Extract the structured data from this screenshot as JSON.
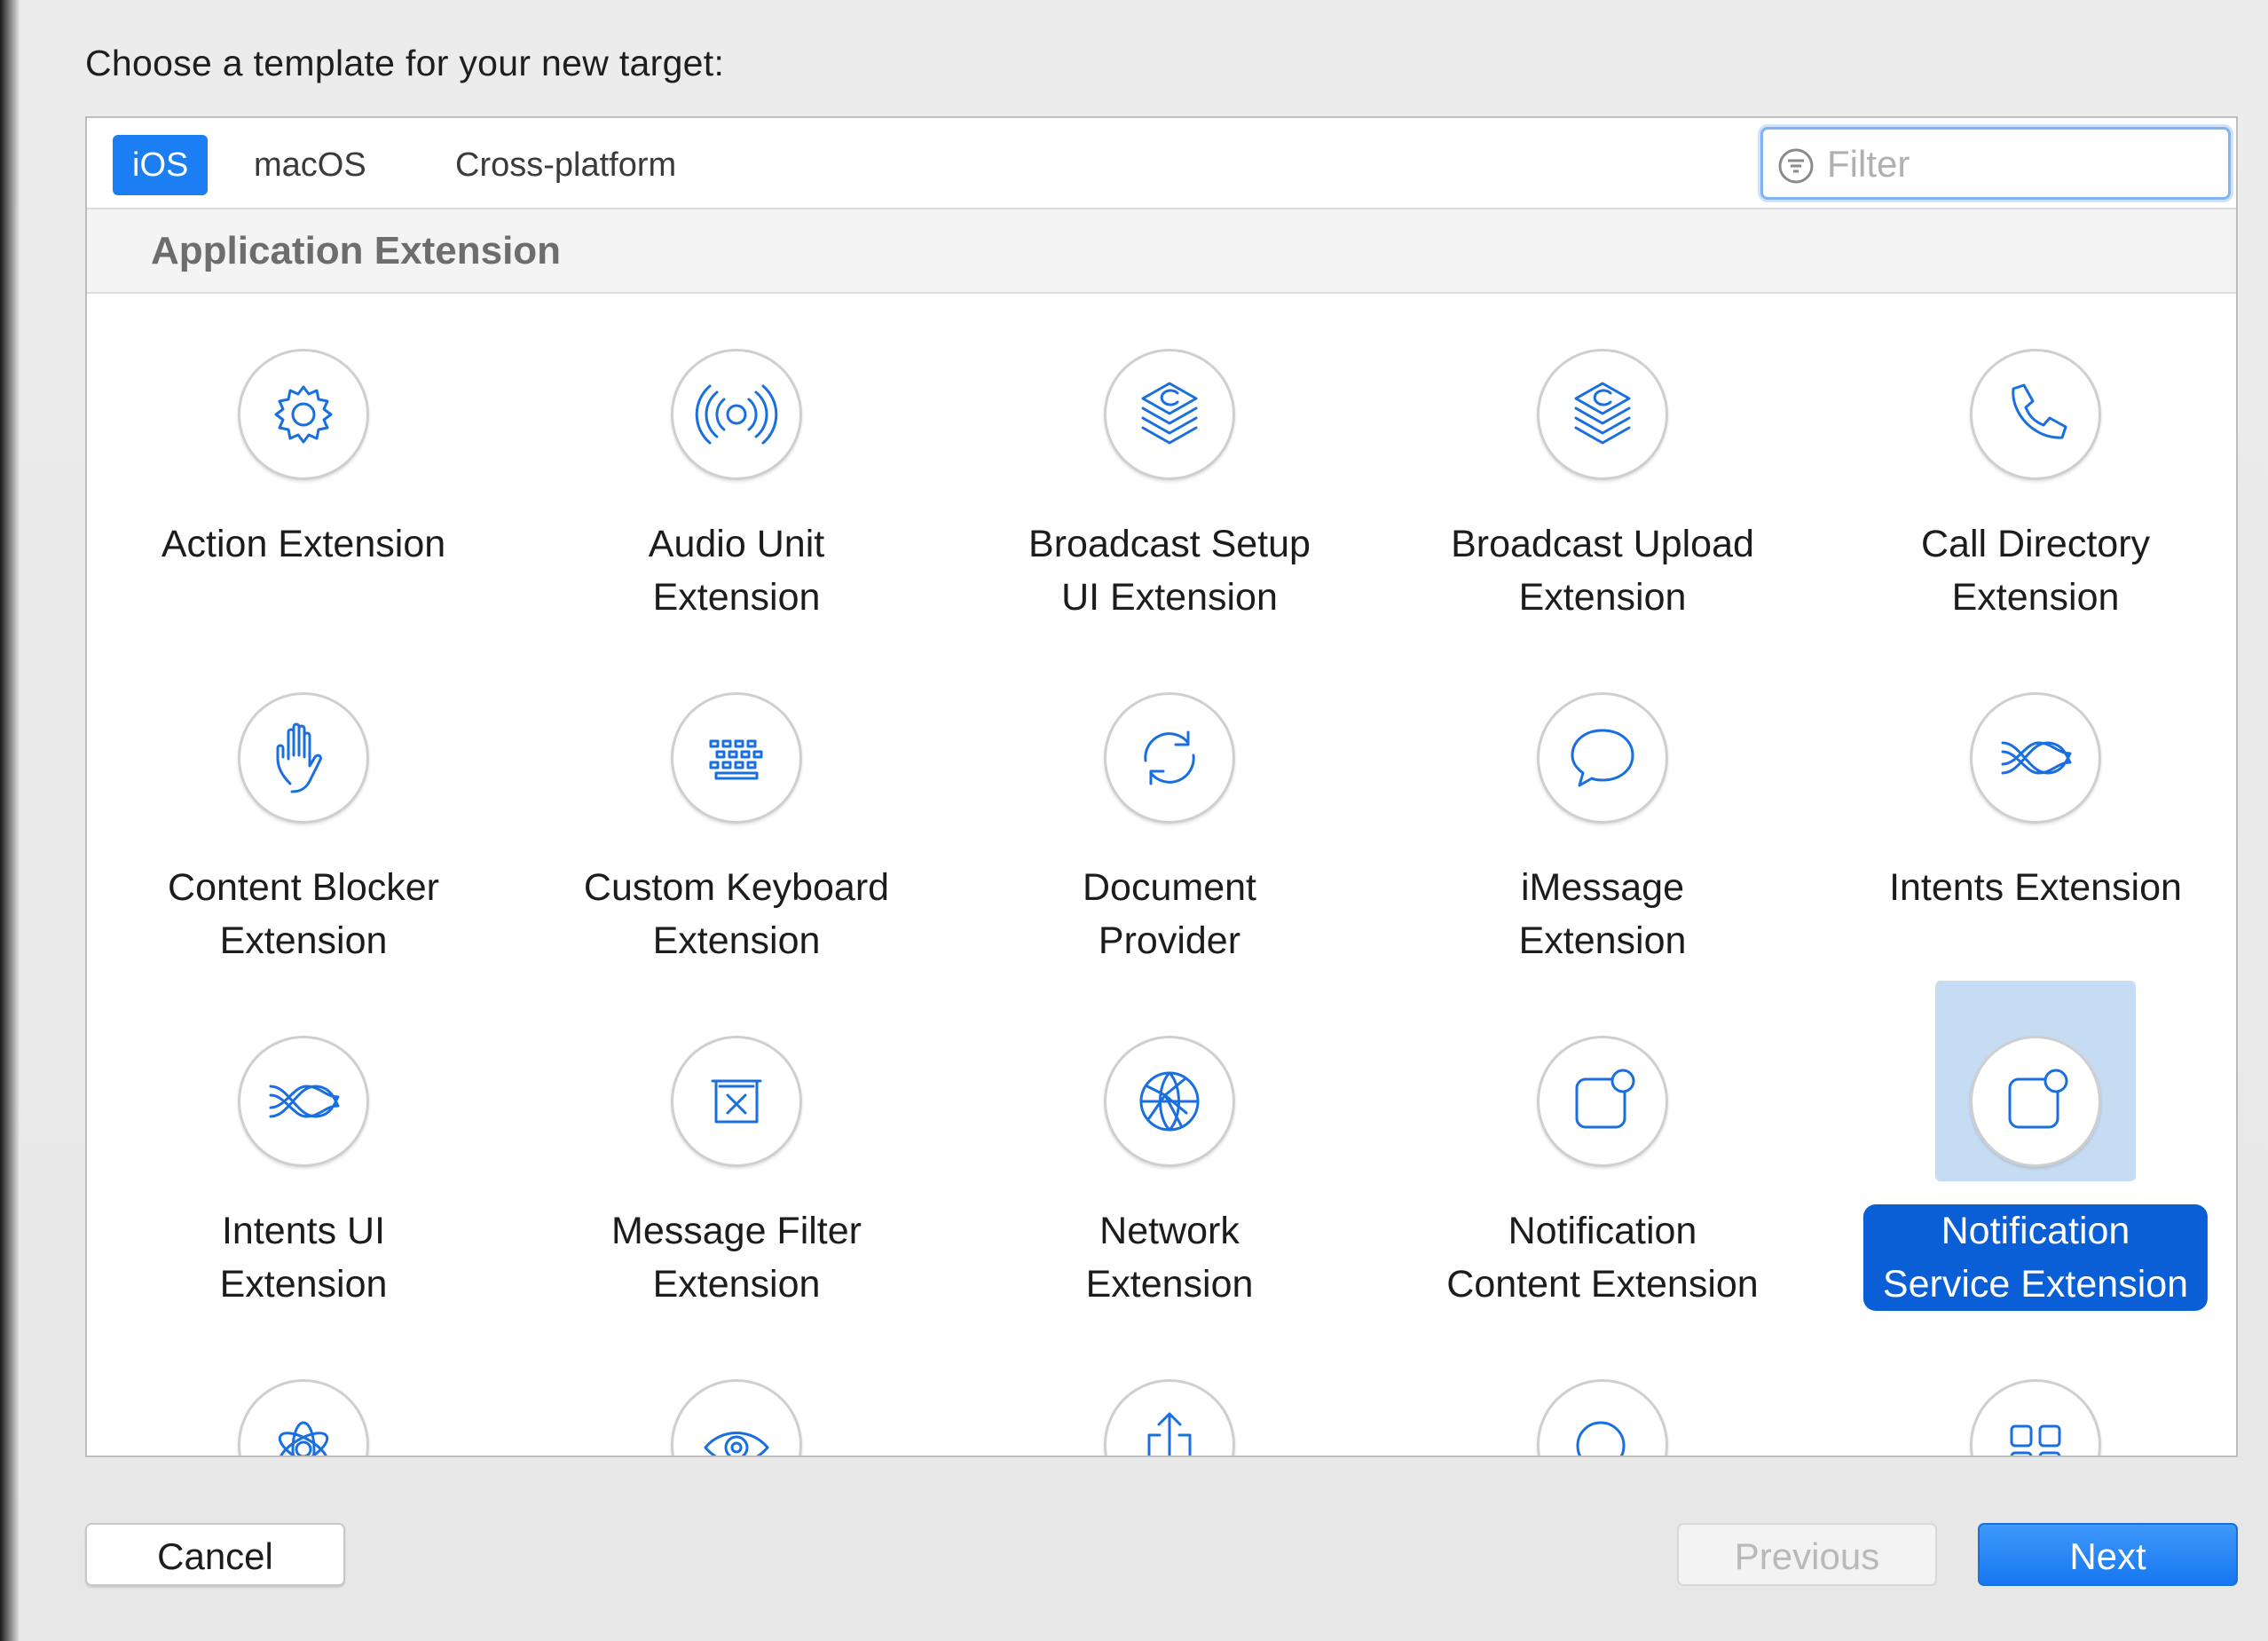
{
  "prompt": "Choose a template for your new target:",
  "tabs": [
    {
      "label": "iOS",
      "active": true
    },
    {
      "label": "macOS",
      "active": false
    },
    {
      "label": "Cross-platform",
      "active": false
    }
  ],
  "filter": {
    "placeholder": "Filter",
    "value": ""
  },
  "section_title": "Application Extension",
  "templates": [
    {
      "icon": "gear-icon",
      "lines": [
        "Action Extension"
      ]
    },
    {
      "icon": "audio-waves-icon",
      "lines": [
        "Audio Unit",
        "Extension"
      ]
    },
    {
      "icon": "broadcast-stack-icon",
      "lines": [
        "Broadcast Setup",
        "UI Extension"
      ]
    },
    {
      "icon": "broadcast-stack-icon",
      "lines": [
        "Broadcast Upload",
        "Extension"
      ]
    },
    {
      "icon": "phone-icon",
      "lines": [
        "Call Directory",
        "Extension"
      ]
    },
    {
      "icon": "hand-icon",
      "lines": [
        "Content Blocker",
        "Extension"
      ]
    },
    {
      "icon": "keyboard-icon",
      "lines": [
        "Custom Keyboard",
        "Extension"
      ]
    },
    {
      "icon": "sync-arrows-icon",
      "lines": [
        "Document",
        "Provider"
      ]
    },
    {
      "icon": "speech-bubble-icon",
      "lines": [
        "iMessage",
        "Extension"
      ]
    },
    {
      "icon": "intents-waves-icon",
      "lines": [
        "Intents Extension"
      ]
    },
    {
      "icon": "intents-waves-icon",
      "lines": [
        "Intents UI",
        "Extension"
      ]
    },
    {
      "icon": "filter-box-icon",
      "lines": [
        "Message Filter",
        "Extension"
      ]
    },
    {
      "icon": "globe-network-icon",
      "lines": [
        "Network",
        "Extension"
      ]
    },
    {
      "icon": "notification-icon",
      "lines": [
        "Notification",
        "Content Extension"
      ]
    },
    {
      "icon": "notification-icon",
      "lines": [
        "Notification",
        "Service Extension"
      ],
      "selected": true
    },
    {
      "icon": "flower-icon",
      "lines": []
    },
    {
      "icon": "eye-icon",
      "lines": []
    },
    {
      "icon": "share-icon",
      "lines": []
    },
    {
      "icon": "magnifier-icon",
      "lines": []
    },
    {
      "icon": "grid-squares-icon",
      "lines": []
    }
  ],
  "buttons": {
    "cancel": "Cancel",
    "previous": "Previous",
    "next": "Next"
  },
  "colors": {
    "accent": "#1b7ef2",
    "selection_label": "#0a5fd6",
    "selection_tile": "#c6dcf2",
    "icon_stroke": "#1a6fe0"
  }
}
